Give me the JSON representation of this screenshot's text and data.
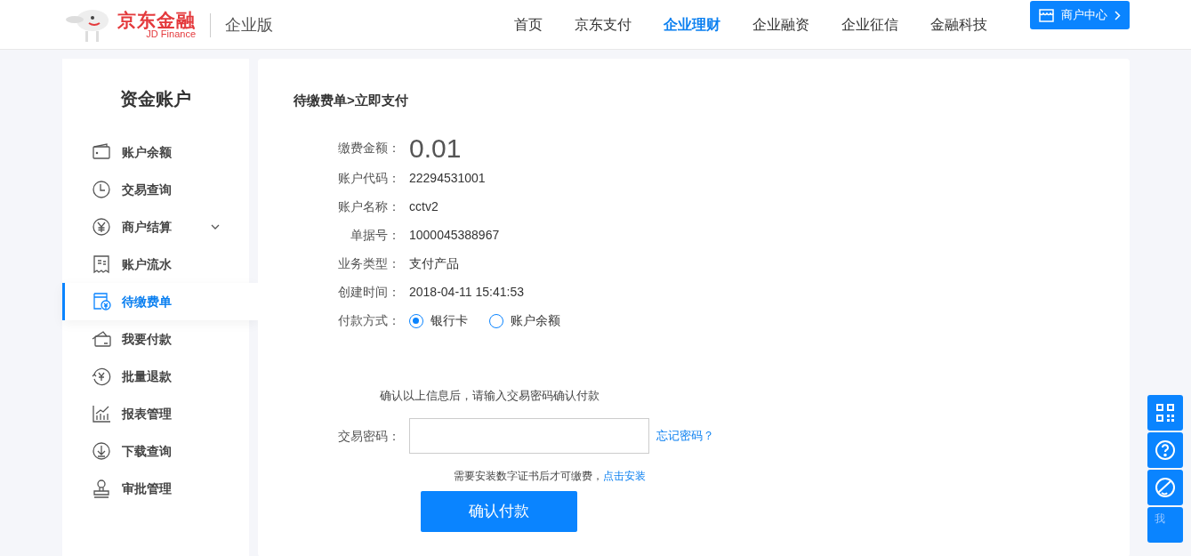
{
  "header": {
    "logo_cn": "京东金融",
    "logo_en": "JD Finance",
    "edition": "企业版",
    "nav": [
      {
        "label": "首页",
        "selected": false
      },
      {
        "label": "京东支付",
        "selected": false
      },
      {
        "label": "企业理财",
        "selected": true
      },
      {
        "label": "企业融资",
        "selected": false
      },
      {
        "label": "企业征信",
        "selected": false
      },
      {
        "label": "金融科技",
        "selected": false
      }
    ],
    "merchant_button": "商户中心"
  },
  "sidebar": {
    "title": "资金账户",
    "items": [
      {
        "label": "账户余额",
        "selected": false
      },
      {
        "label": "交易查询",
        "selected": false
      },
      {
        "label": "商户结算",
        "selected": false,
        "expanded": false
      },
      {
        "label": "账户流水",
        "selected": false
      },
      {
        "label": "待缴费单",
        "selected": true
      },
      {
        "label": "我要付款",
        "selected": false
      },
      {
        "label": "批量退款",
        "selected": false
      },
      {
        "label": "报表管理",
        "selected": false
      },
      {
        "label": "下载查询",
        "selected": false
      },
      {
        "label": "审批管理",
        "selected": false
      }
    ]
  },
  "main": {
    "breadcrumb": "待缴费单>立即支付",
    "fields": [
      {
        "label": "缴费金额：",
        "value": "0.01",
        "kind": "amount"
      },
      {
        "label": "账户代码：",
        "value": "22294531001",
        "kind": "text"
      },
      {
        "label": "账户名称：",
        "value": "cctv2",
        "kind": "text"
      },
      {
        "label": "单据号：",
        "value": "1000045388967",
        "kind": "text"
      },
      {
        "label": "业务类型：",
        "value": "支付产品",
        "kind": "text"
      },
      {
        "label": "创建时间：",
        "value": "2018-04-11 15:41:53",
        "kind": "text"
      }
    ],
    "payment_method": {
      "label": "付款方式：",
      "options": [
        {
          "label": "银行卡",
          "selected": true
        },
        {
          "label": "账户余额",
          "selected": false
        }
      ]
    },
    "confirm_note": "确认以上信息后，请输入交易密码确认付款",
    "password": {
      "label": "交易密码：",
      "forgot_link": "忘记密码？"
    },
    "cert_note": "需要安装数字证书后才可缴费，",
    "install_link": "点击安装",
    "submit": "确认付款"
  },
  "float_bar": {
    "me_label": "我"
  }
}
